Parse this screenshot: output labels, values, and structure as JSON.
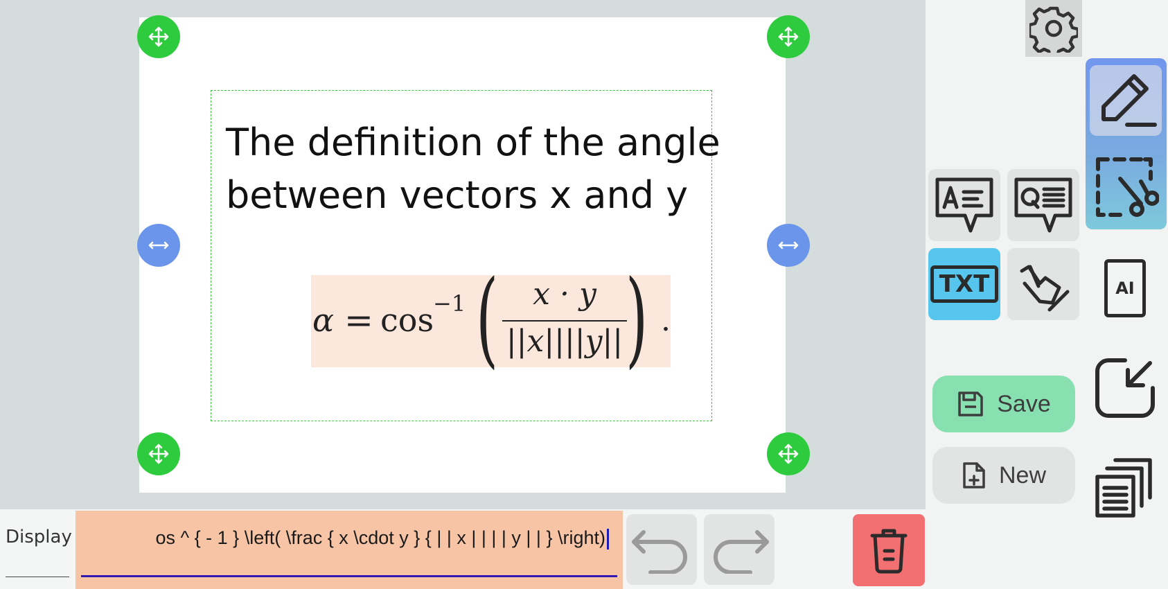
{
  "canvas": {
    "text_lines": [
      "The definition of the angle",
      "between vectors x and y"
    ],
    "formula": {
      "alpha": "α",
      "equals": "=",
      "func": "cos",
      "exponent": "−1",
      "numerator": "x · y",
      "denominator": "||x||||y||",
      "trailing": "."
    }
  },
  "editor": {
    "display_label": "Display",
    "latex_value": "os ^ { - 1 } \\left( \\frac { x \\cdot y } { | | x | | | | y | | } \\right)"
  },
  "side_panel": {
    "save_label": "Save",
    "new_label": "New",
    "txt_label": "TXT",
    "ai_label": "AI"
  },
  "colors": {
    "canvas_bg": "#d5dcdc",
    "move_handle": "#2ecb3f",
    "resize_handle": "#6b95ea",
    "formula_bg": "#fce7dd",
    "latex_field_bg": "#f7c4a6",
    "save_bg": "#88dfb0",
    "trash_bg": "#f37072",
    "txt_active": "#56c6ef"
  }
}
